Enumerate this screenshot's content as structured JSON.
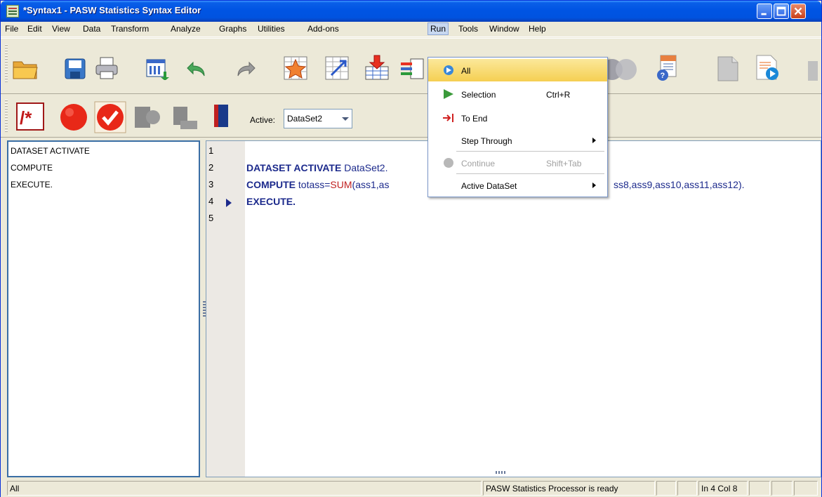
{
  "window": {
    "title": "*Syntax1 - PASW Statistics Syntax Editor"
  },
  "menubar": [
    {
      "label": "File"
    },
    {
      "label": "Edit"
    },
    {
      "label": "View"
    },
    {
      "label": "Data"
    },
    {
      "label": "Transform"
    },
    {
      "label": "Analyze"
    },
    {
      "label": "Graphs"
    },
    {
      "label": "Utilities"
    },
    {
      "label": "Add-ons"
    },
    {
      "label": "Run"
    },
    {
      "label": "Tools"
    },
    {
      "label": "Window"
    },
    {
      "label": "Help"
    }
  ],
  "toolbar2": {
    "active_label": "Active:",
    "active_dataset": "DataSet2"
  },
  "navigator": {
    "lines": [
      "DATASET ACTIVATE",
      "COMPUTE",
      "EXECUTE."
    ]
  },
  "editor": {
    "line_numbers": [
      "1",
      "2",
      "3",
      "4",
      "5"
    ],
    "line2": {
      "kw": "DATASET ACTIVATE",
      "rest": " DataSet2."
    },
    "line3": {
      "kw": "COMPUTE",
      "a": " totass=",
      "fn": "SUM",
      "b": "(ass1,as",
      "c": "ss8,ass9,ass10,ass11,ass12)."
    },
    "line4": {
      "kw": "EXECUTE."
    }
  },
  "run_menu": {
    "items": [
      {
        "label": "All",
        "shortcut": ""
      },
      {
        "label": "Selection",
        "shortcut": "Ctrl+R"
      },
      {
        "label": "To End",
        "shortcut": ""
      },
      {
        "label": "Step Through",
        "shortcut": ""
      },
      {
        "label": "Continue",
        "shortcut": "Shift+Tab"
      },
      {
        "label": "Active DataSet",
        "shortcut": ""
      }
    ]
  },
  "statusbar": {
    "left": "All",
    "processor": "PASW Statistics Processor is ready",
    "position": "In 4 Col 8"
  }
}
